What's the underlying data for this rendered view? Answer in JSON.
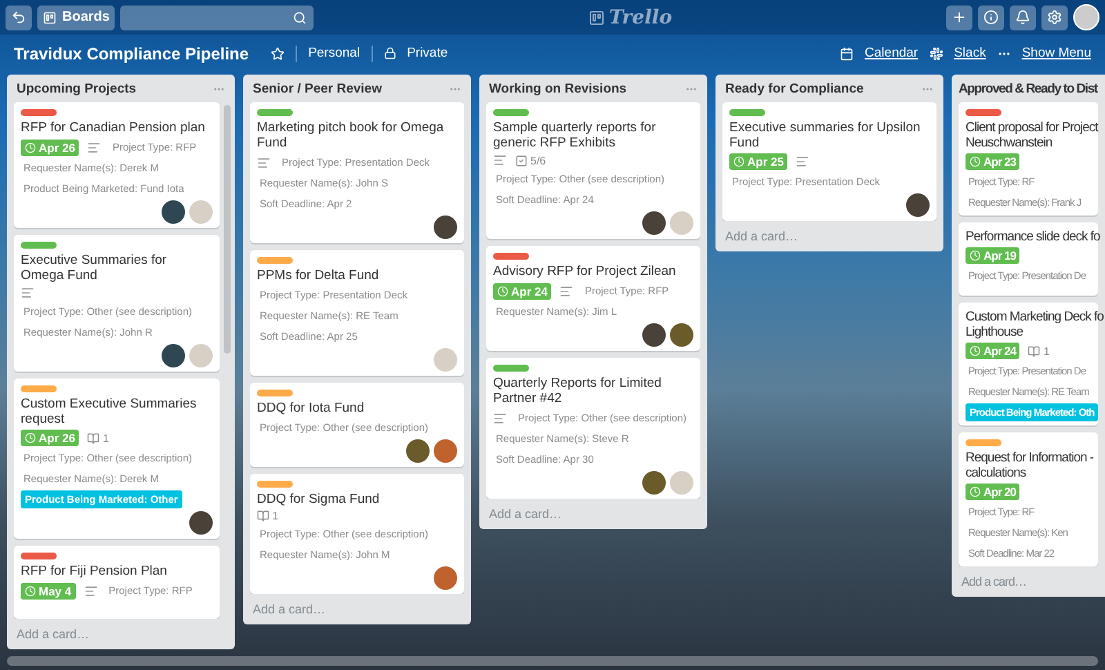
{
  "topbar": {
    "boards_label": "Boards",
    "logo": "Trello"
  },
  "board": {
    "title": "Travidux Compliance Pipeline",
    "starred": false,
    "team": "Personal",
    "visibility": "Private",
    "links": [
      {
        "kind": "calendar",
        "label": "Calendar"
      },
      {
        "kind": "slack",
        "label": "Slack"
      },
      {
        "kind": "menu",
        "label": "Show Menu"
      }
    ]
  },
  "lists": [
    {
      "name": "Upcoming Projects",
      "scrollable": true,
      "add_card": "Add a card…",
      "cards": [
        {
          "color": "#eb5a46",
          "title": "RFP for Canadian Pension plan",
          "due": "Apr 26",
          "description": true,
          "fields": [
            {
              "text": "Project Type: RFP",
              "highlighted": false
            },
            {
              "text": "Requester Name(s): Derek M",
              "highlighted": false
            },
            {
              "text": "Product Being Marketed: Fund Iota",
              "highlighted": false
            }
          ],
          "members": [
            {
              "color": "#2e4752"
            },
            {
              "color": "#d8d0c4"
            }
          ]
        },
        {
          "color": "#61bd4f",
          "title": "Executive Summaries for Omega Fund",
          "description": true,
          "fields": [
            {
              "text": "Project Type: Other (see description)",
              "highlighted": false
            },
            {
              "text": "Requester Name(s): John R",
              "highlighted": false
            }
          ],
          "members": [
            {
              "color": "#2e4752"
            },
            {
              "color": "#d8d0c4"
            }
          ]
        },
        {
          "color": "#ffab4a",
          "title": "Custom Executive Summaries request",
          "due": "Apr 26",
          "description": false,
          "attachments": "1",
          "fields": [
            {
              "text": "Project Type: Other (see description)",
              "highlighted": false
            },
            {
              "text": "Requester Name(s): Derek M",
              "highlighted": false
            },
            {
              "text": "Product Being Marketed: Other",
              "highlighted": true
            }
          ],
          "members": [
            {
              "color": "#4a4238"
            }
          ]
        },
        {
          "color": "#eb5a46",
          "title": "RFP for Fiji Pension Plan",
          "due": "May 4",
          "description": true,
          "fields": [
            {
              "text": "Project Type: RFP",
              "highlighted": false
            }
          ]
        }
      ]
    },
    {
      "name": "Senior / Peer Review",
      "scrollable": false,
      "add_card": "Add a card…",
      "cards": [
        {
          "color": "#61bd4f",
          "title": "Marketing pitch book for Omega Fund",
          "description": true,
          "fields": [
            {
              "text": "Project Type: Presentation Deck",
              "highlighted": false
            },
            {
              "text": "Requester Name(s): John S",
              "highlighted": false
            },
            {
              "text": "Soft Deadline: Apr 2",
              "highlighted": false
            }
          ],
          "members": [
            {
              "color": "#4a4238"
            }
          ]
        },
        {
          "color": "#ffab4a",
          "title": "PPMs for Delta Fund",
          "description": false,
          "fields": [
            {
              "text": "Project Type: Presentation Deck",
              "highlighted": false
            },
            {
              "text": "Requester Name(s): RE Team",
              "highlighted": false
            },
            {
              "text": "Soft Deadline: Apr 25",
              "highlighted": false
            }
          ],
          "members": [
            {
              "color": "#d8d0c4"
            }
          ]
        },
        {
          "color": "#ffab4a",
          "title": "DDQ for Iota Fund",
          "description": false,
          "fields": [
            {
              "text": "Project Type: Other (see description)",
              "highlighted": false
            }
          ],
          "members": [
            {
              "color": "#6b5a2a"
            },
            {
              "color": "#c0622e"
            }
          ]
        },
        {
          "color": "#ffab4a",
          "title": "DDQ for Sigma Fund",
          "description": false,
          "attachments": "1",
          "fields": [
            {
              "text": "Project Type: Other (see description)",
              "highlighted": false
            },
            {
              "text": "Requester Name(s): John M",
              "highlighted": false
            }
          ],
          "members": [
            {
              "color": "#c0622e"
            }
          ]
        }
      ]
    },
    {
      "name": "Working on Revisions",
      "scrollable": false,
      "add_card": "Add a card…",
      "cards": [
        {
          "color": "#61bd4f",
          "title": "Sample quarterly reports for generic RFP Exhibits",
          "description": true,
          "checklist": "5/6",
          "fields": [
            {
              "text": "Project Type: Other (see description)",
              "highlighted": false
            },
            {
              "text": "Soft Deadline: Apr 24",
              "highlighted": false
            }
          ],
          "members": [
            {
              "color": "#4a4238"
            },
            {
              "color": "#d8d0c4"
            }
          ]
        },
        {
          "color": "#eb5a46",
          "title": "Advisory RFP for Project Zilean",
          "due": "Apr 24",
          "description": true,
          "fields": [
            {
              "text": "Project Type: RFP",
              "highlighted": false
            },
            {
              "text": "Requester Name(s): Jim L",
              "highlighted": false
            }
          ],
          "members": [
            {
              "color": "#4a4238"
            },
            {
              "color": "#6b5a2a"
            }
          ]
        },
        {
          "color": "#61bd4f",
          "title": "Quarterly Reports for Limited Partner #42",
          "description": true,
          "fields": [
            {
              "text": "Project Type: Other (see description)",
              "highlighted": false
            },
            {
              "text": "Requester Name(s): Steve R",
              "highlighted": false
            },
            {
              "text": "Soft Deadline: Apr 30",
              "highlighted": false
            }
          ],
          "members": [
            {
              "color": "#6b5a2a"
            },
            {
              "color": "#d8d0c4"
            }
          ]
        }
      ]
    },
    {
      "name": "Ready for Compliance",
      "scrollable": false,
      "add_card": "Add a card…",
      "cards": [
        {
          "color": "#61bd4f",
          "title": "Executive summaries for Upsilon Fund",
          "due": "Apr 25",
          "description": true,
          "fields": [
            {
              "text": "Project Type: Presentation Deck",
              "highlighted": false
            }
          ],
          "members": [
            {
              "color": "#4a4238"
            }
          ]
        }
      ]
    },
    {
      "name": "Approved & Ready to Dist",
      "scrollable": false,
      "add_card": "Add a card…",
      "cards": [
        {
          "color": "#eb5a46",
          "title": "Client proposal for Project\nNeuschwanstein",
          "due": "Apr 23",
          "description": false,
          "fields": [
            {
              "text": "Project Type: RF",
              "highlighted": false
            },
            {
              "text": "Requester Name(s): Frank J",
              "highlighted": false
            }
          ]
        },
        {
          "title": "Performance slide deck fo",
          "due": "Apr 19",
          "description": false,
          "fields": [
            {
              "text": "Project Type: Presentation De",
              "highlighted": false
            }
          ]
        },
        {
          "title": "Custom Marketing Deck fo\nLighthouse",
          "due": "Apr 24",
          "description": false,
          "attachments": "1",
          "fields": [
            {
              "text": "Project Type: Presentation De",
              "highlighted": false
            },
            {
              "text": "Requester Name(s): RE Team",
              "highlighted": false
            },
            {
              "text": "Product Being Marketed: Oth",
              "highlighted": true
            }
          ]
        },
        {
          "color": "#ffab4a",
          "title": "Request for Information -\ncalculations",
          "due": "Apr 20",
          "description": false,
          "fields": [
            {
              "text": "Project Type: RF",
              "highlighted": false
            },
            {
              "text": "Requester Name(s): Ken",
              "highlighted": false
            },
            {
              "text": "Soft Deadline: Mar 22",
              "highlighted": false
            }
          ]
        }
      ]
    }
  ]
}
